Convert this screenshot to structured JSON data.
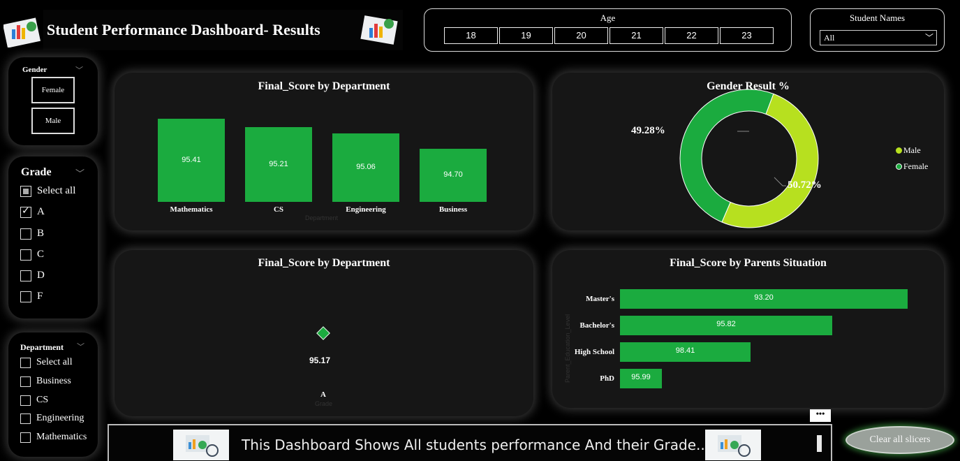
{
  "header": {
    "title": "Student Performance Dashboard- Results"
  },
  "age_slicer": {
    "label": "Age",
    "items": [
      "18",
      "19",
      "20",
      "21",
      "22",
      "23"
    ]
  },
  "names_slicer": {
    "label": "Student Names",
    "selected": "All"
  },
  "gender_slicer": {
    "label": "Gender",
    "items": [
      "Female",
      "Male"
    ]
  },
  "grade_slicer": {
    "label": "Grade",
    "items": [
      {
        "label": "Select all",
        "state": "partial"
      },
      {
        "label": "A",
        "state": "checked"
      },
      {
        "label": "B",
        "state": "unchecked"
      },
      {
        "label": "C",
        "state": "unchecked"
      },
      {
        "label": "D",
        "state": "unchecked"
      },
      {
        "label": "F",
        "state": "unchecked"
      }
    ]
  },
  "department_slicer": {
    "label": "Department",
    "items": [
      "Select all",
      "Business",
      "CS",
      "Engineering",
      "Mathematics"
    ]
  },
  "charts": {
    "dept_bar": {
      "title": "Final_Score by Department",
      "xlabel": "Department"
    },
    "gender_donut": {
      "title": "Gender Result %",
      "legend": [
        "Male",
        "Female"
      ],
      "pct_female": "49.28%",
      "pct_male": "50.72%"
    },
    "grade_scatter": {
      "title": "Final_Score by Department",
      "point_label": "95.17",
      "category": "A",
      "xlabel": "Grade"
    },
    "parents_bar": {
      "title": "Final_Score by Parents Situation",
      "ylabel": "Parent_Education_Level"
    }
  },
  "chart_data": [
    {
      "type": "bar",
      "title": "Final_Score by Department",
      "xlabel": "Department",
      "categories": [
        "Mathematics",
        "CS",
        "Engineering",
        "Business"
      ],
      "values": [
        95.41,
        95.21,
        95.06,
        94.7
      ]
    },
    {
      "type": "pie",
      "title": "Gender Result %",
      "categories": [
        "Male",
        "Female"
      ],
      "values": [
        50.72,
        49.28
      ],
      "colors": [
        "#b7e01f",
        "#1bab3f"
      ]
    },
    {
      "type": "scatter",
      "title": "Final_Score by Department",
      "xlabel": "Grade",
      "categories": [
        "A"
      ],
      "values": [
        95.17
      ]
    },
    {
      "type": "bar",
      "title": "Final_Score by Parents Situation",
      "ylabel": "Parent_Education_Level",
      "categories": [
        "Master's",
        "Bachelor's",
        "High School",
        "PhD"
      ],
      "values": [
        93.2,
        95.82,
        98.41,
        95.99
      ]
    }
  ],
  "footer": {
    "text": "This Dashboard Shows All students performance And their Grade...",
    "clear_label": "Clear all slicers",
    "more": "•••"
  },
  "colors": {
    "bar": "#1bab3f",
    "male": "#b7e01f",
    "female": "#1bab3f"
  }
}
